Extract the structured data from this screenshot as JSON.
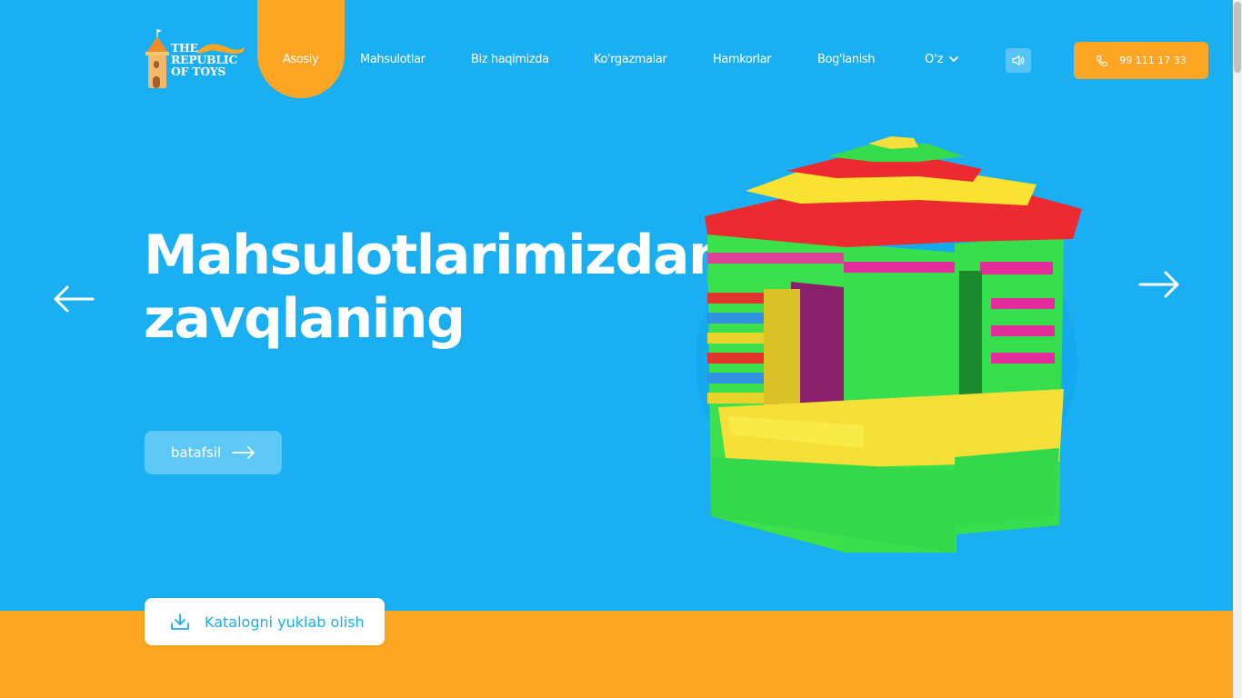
{
  "logo": {
    "line1": "THE",
    "line2": "REPUBLIC",
    "line3": "OF TOYS"
  },
  "nav": {
    "items": [
      {
        "label": "Asosiy"
      },
      {
        "label": "Mahsulotlar"
      },
      {
        "label": "Biz haqimizda"
      },
      {
        "label": "Ko'rgazmalar"
      },
      {
        "label": "Hamkorlar"
      },
      {
        "label": "Bog'lanish"
      }
    ],
    "language": "O'z",
    "phone": "99 111 17 33"
  },
  "hero": {
    "title_line1": "Mahsulotlarimizdan",
    "title_line2": "zavqlaning",
    "detail_label": "batafsil"
  },
  "catalog": {
    "label": "Katalogni yuklab olish"
  },
  "icons": [
    "castle-logo-icon",
    "chevron-down-icon",
    "speaker-icon",
    "phone-icon",
    "arrow-right-icon",
    "arrow-left-icon",
    "download-icon"
  ],
  "colors": {
    "primary_blue": "#1aaff2",
    "accent_orange": "#fea623",
    "light_blue": "#5ec8f6"
  }
}
